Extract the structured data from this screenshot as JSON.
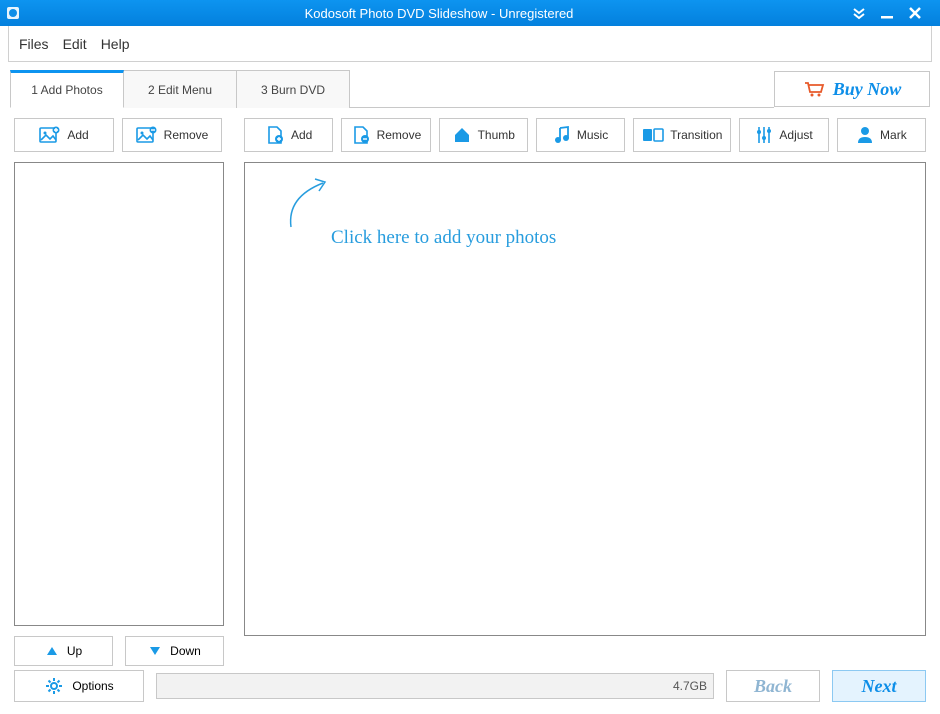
{
  "titlebar": {
    "title": "Kodosoft Photo DVD Slideshow - Unregistered"
  },
  "menu": {
    "files": "Files",
    "edit": "Edit",
    "help": "Help"
  },
  "tabs": {
    "t1": "1 Add Photos",
    "t2": "2 Edit Menu",
    "t3": "3 Burn DVD"
  },
  "buy_now": "Buy Now",
  "left_toolbar": {
    "add": "Add",
    "remove": "Remove"
  },
  "right_toolbar": {
    "add": "Add",
    "remove": "Remove",
    "thumb": "Thumb",
    "music": "Music",
    "transition": "Transition",
    "adjust": "Adjust",
    "mark": "Mark"
  },
  "up_down": {
    "up": "Up",
    "down": "Down"
  },
  "hint": "Click here to add your photos",
  "footer": {
    "options": "Options",
    "size": "4.7GB",
    "back": "Back",
    "next": "Next"
  }
}
